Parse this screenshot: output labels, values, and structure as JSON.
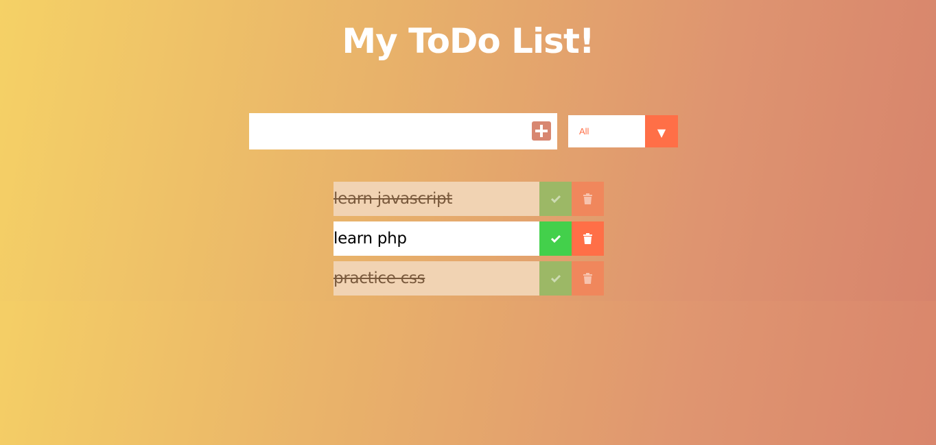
{
  "page": {
    "title": "My ToDo List!"
  },
  "form": {
    "input_value": "",
    "input_placeholder": "",
    "add_icon": "plus-square-icon",
    "filter_selected": "All",
    "filter_arrow_icon": "triangle-down-icon"
  },
  "todos": [
    {
      "text": "learn javascript",
      "completed": true
    },
    {
      "text": "learn php",
      "completed": false
    },
    {
      "text": "practice css",
      "completed": true
    }
  ],
  "colors": {
    "accent": "#ff6f47",
    "complete_green": "#43d04b",
    "add_button": "#d88771"
  }
}
